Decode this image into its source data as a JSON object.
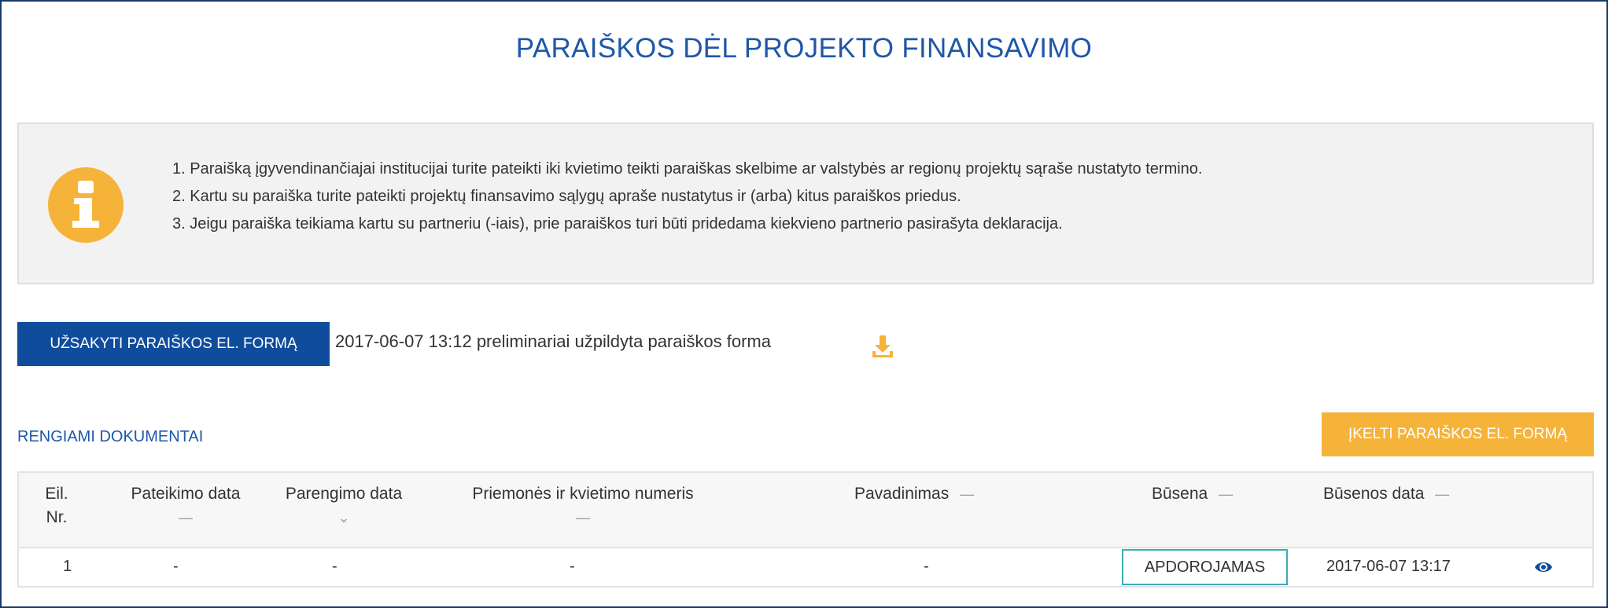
{
  "page": {
    "title": "PARAIŠKOS DĖL PROJEKTO FINANSAVIMO"
  },
  "info": {
    "icon": "info-icon",
    "items": [
      "1.  Paraišką įgyvendinančiajai institucijai turite pateikti iki kvietimo teikti paraiškas skelbime ar valstybės ar regionų projektų sąraše nustatyto termino.",
      "2.  Kartu su paraiška turite pateikti projektų finansavimo sąlygų apraše nustatytus ir (arba) kitus paraiškos priedus.",
      "3.  Jeigu paraiška teikiama kartu su partneriu (-iais), prie paraiškos turi būti pridedama kiekvieno partnerio pasirašyta deklaracija."
    ]
  },
  "actions": {
    "order_label": "UŽSAKYTI PARAIŠKOS EL. FORMĄ",
    "prefilled_text": "2017-06-07 13:12 preliminariai užpildyta paraiškos forma",
    "download_icon": "download-icon",
    "upload_label": "ĮKELTI PARAIŠKOS EL. FORMĄ"
  },
  "section": {
    "label": "RENGIAMI DOKUMENTAI"
  },
  "table": {
    "headers": {
      "nr_line1": "Eil.",
      "nr_line2": "Nr.",
      "submitted": "Pateikimo data",
      "prepared": "Parengimo data",
      "measure": "Priemonės ir kvietimo numeris",
      "name": "Pavadinimas",
      "status": "Būsena",
      "status_date": "Būsenos data"
    },
    "sort_marks": {
      "dash": "—",
      "down": "⌄"
    },
    "rows": [
      {
        "nr": "1",
        "submitted": "-",
        "prepared": "-",
        "measure": "-",
        "name": "-",
        "status": "APDOROJAMAS",
        "status_date": "2017-06-07 13:17",
        "view_icon": "eye-icon"
      }
    ]
  },
  "colors": {
    "primary": "#0f4c9c",
    "title_blue": "#1f57a8",
    "accent_orange": "#f6b33a",
    "status_border": "#3aaeb8"
  }
}
